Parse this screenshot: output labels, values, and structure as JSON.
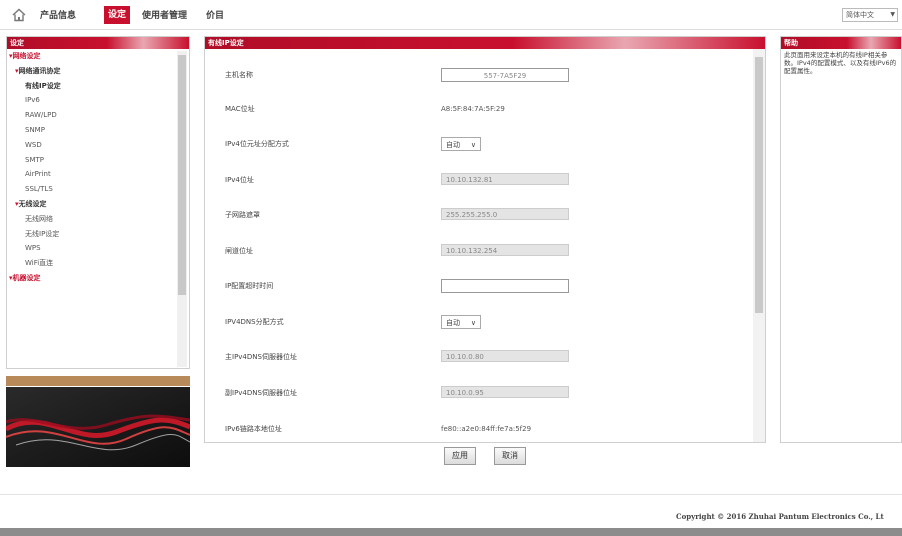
{
  "nav": {
    "items": [
      "产品信息",
      "设定",
      "使用者管理",
      "价目"
    ],
    "language": "简体中文",
    "active": "设定"
  },
  "sidebar": {
    "title": "设定",
    "items": [
      {
        "label": "网络设定",
        "level": 0
      },
      {
        "label": "网络通讯协定",
        "level": 1
      },
      {
        "label": "有线IP设定",
        "level": 2,
        "selected": true
      },
      {
        "label": "IPv6",
        "level": 2
      },
      {
        "label": "RAW/LPD",
        "level": 2
      },
      {
        "label": "SNMP",
        "level": 2
      },
      {
        "label": "WSD",
        "level": 2
      },
      {
        "label": "SMTP",
        "level": 2
      },
      {
        "label": "AirPrint",
        "level": 2
      },
      {
        "label": "SSL/TLS",
        "level": 2
      },
      {
        "label": "无线设定",
        "level": 1
      },
      {
        "label": "无线网络",
        "level": 2
      },
      {
        "label": "无线IP设定",
        "level": 2
      },
      {
        "label": "WPS",
        "level": 2
      },
      {
        "label": "WiFi直连",
        "level": 2
      },
      {
        "label": "机器设定",
        "level": 0
      }
    ]
  },
  "main": {
    "title": "有线IP设定",
    "fields": [
      {
        "label": "主机名称",
        "value": "557-7A5F29",
        "kind": "input"
      },
      {
        "label": "MAC位址",
        "value": "A8:5F:84:7A:5F:29",
        "kind": "text"
      },
      {
        "label": "IPv4位元址分配方式",
        "value": "自动",
        "kind": "select"
      },
      {
        "label": "IPv4位址",
        "value": "10.10.132.81",
        "kind": "disabled"
      },
      {
        "label": "子网路遮罩",
        "value": "255.255.255.0",
        "kind": "disabled"
      },
      {
        "label": "闸道位址",
        "value": "10.10.132.254",
        "kind": "disabled"
      },
      {
        "label": "IP配置超时时间",
        "value": "",
        "kind": "input"
      },
      {
        "label": "IPV4DNS分配方式",
        "value": "自动",
        "kind": "select"
      },
      {
        "label": "主IPv4DNS伺服器位址",
        "value": "10.10.0.80",
        "kind": "disabled"
      },
      {
        "label": "副IPv4DNS伺服器位址",
        "value": "10.10.0.95",
        "kind": "disabled"
      },
      {
        "label": "IPv6链路本地位址",
        "value": "fe80::a2e0:84ff:fe7a:5f29",
        "kind": "text"
      }
    ],
    "buttons": {
      "apply": "应用",
      "cancel": "取消"
    }
  },
  "help": {
    "title": "帮助",
    "text": "此页面用来设定本机的有线IP相关参数。IPv4的配置模式、以及有线IPv6的配置属性。"
  },
  "footer": {
    "copyright": "Copyright © 2016 Zhuhai Pantum Electronics Co., Lt"
  },
  "colors": {
    "accent": "#c8102e"
  }
}
